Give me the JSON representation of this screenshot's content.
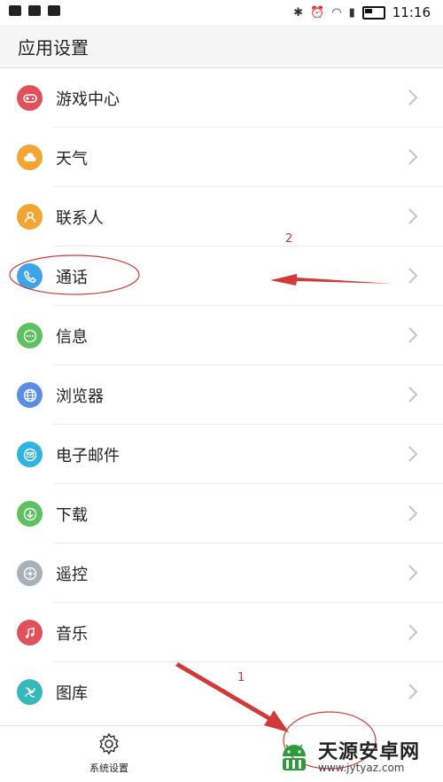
{
  "status_bar": {
    "time": "11:16"
  },
  "header": {
    "title": "应用设置"
  },
  "list": [
    {
      "label": "游戏中心",
      "icon": "gamepad-icon",
      "color": "#e2505a"
    },
    {
      "label": "天气",
      "icon": "weather-icon",
      "color": "#f3a433"
    },
    {
      "label": "联系人",
      "icon": "contacts-icon",
      "color": "#f3a433"
    },
    {
      "label": "通话",
      "icon": "phone-icon",
      "color": "#3ea4ea"
    },
    {
      "label": "信息",
      "icon": "message-icon",
      "color": "#5cc15f"
    },
    {
      "label": "浏览器",
      "icon": "globe-icon",
      "color": "#5a8de5"
    },
    {
      "label": "电子邮件",
      "icon": "mail-icon",
      "color": "#2db4e0"
    },
    {
      "label": "下载",
      "icon": "download-icon",
      "color": "#5cc15f"
    },
    {
      "label": "遥控",
      "icon": "remote-icon",
      "color": "#a8b0b8"
    },
    {
      "label": "音乐",
      "icon": "music-icon",
      "color": "#e2505a"
    },
    {
      "label": "图库",
      "icon": "gallery-icon",
      "color": "#35b9bb"
    }
  ],
  "bottom_nav": {
    "system_settings": "系统设置"
  },
  "annotations": {
    "label_1": "1",
    "label_2": "2",
    "color": "#d23a3a"
  },
  "watermark": {
    "title": "天源安卓网",
    "url": "www.jytyaz.com"
  }
}
